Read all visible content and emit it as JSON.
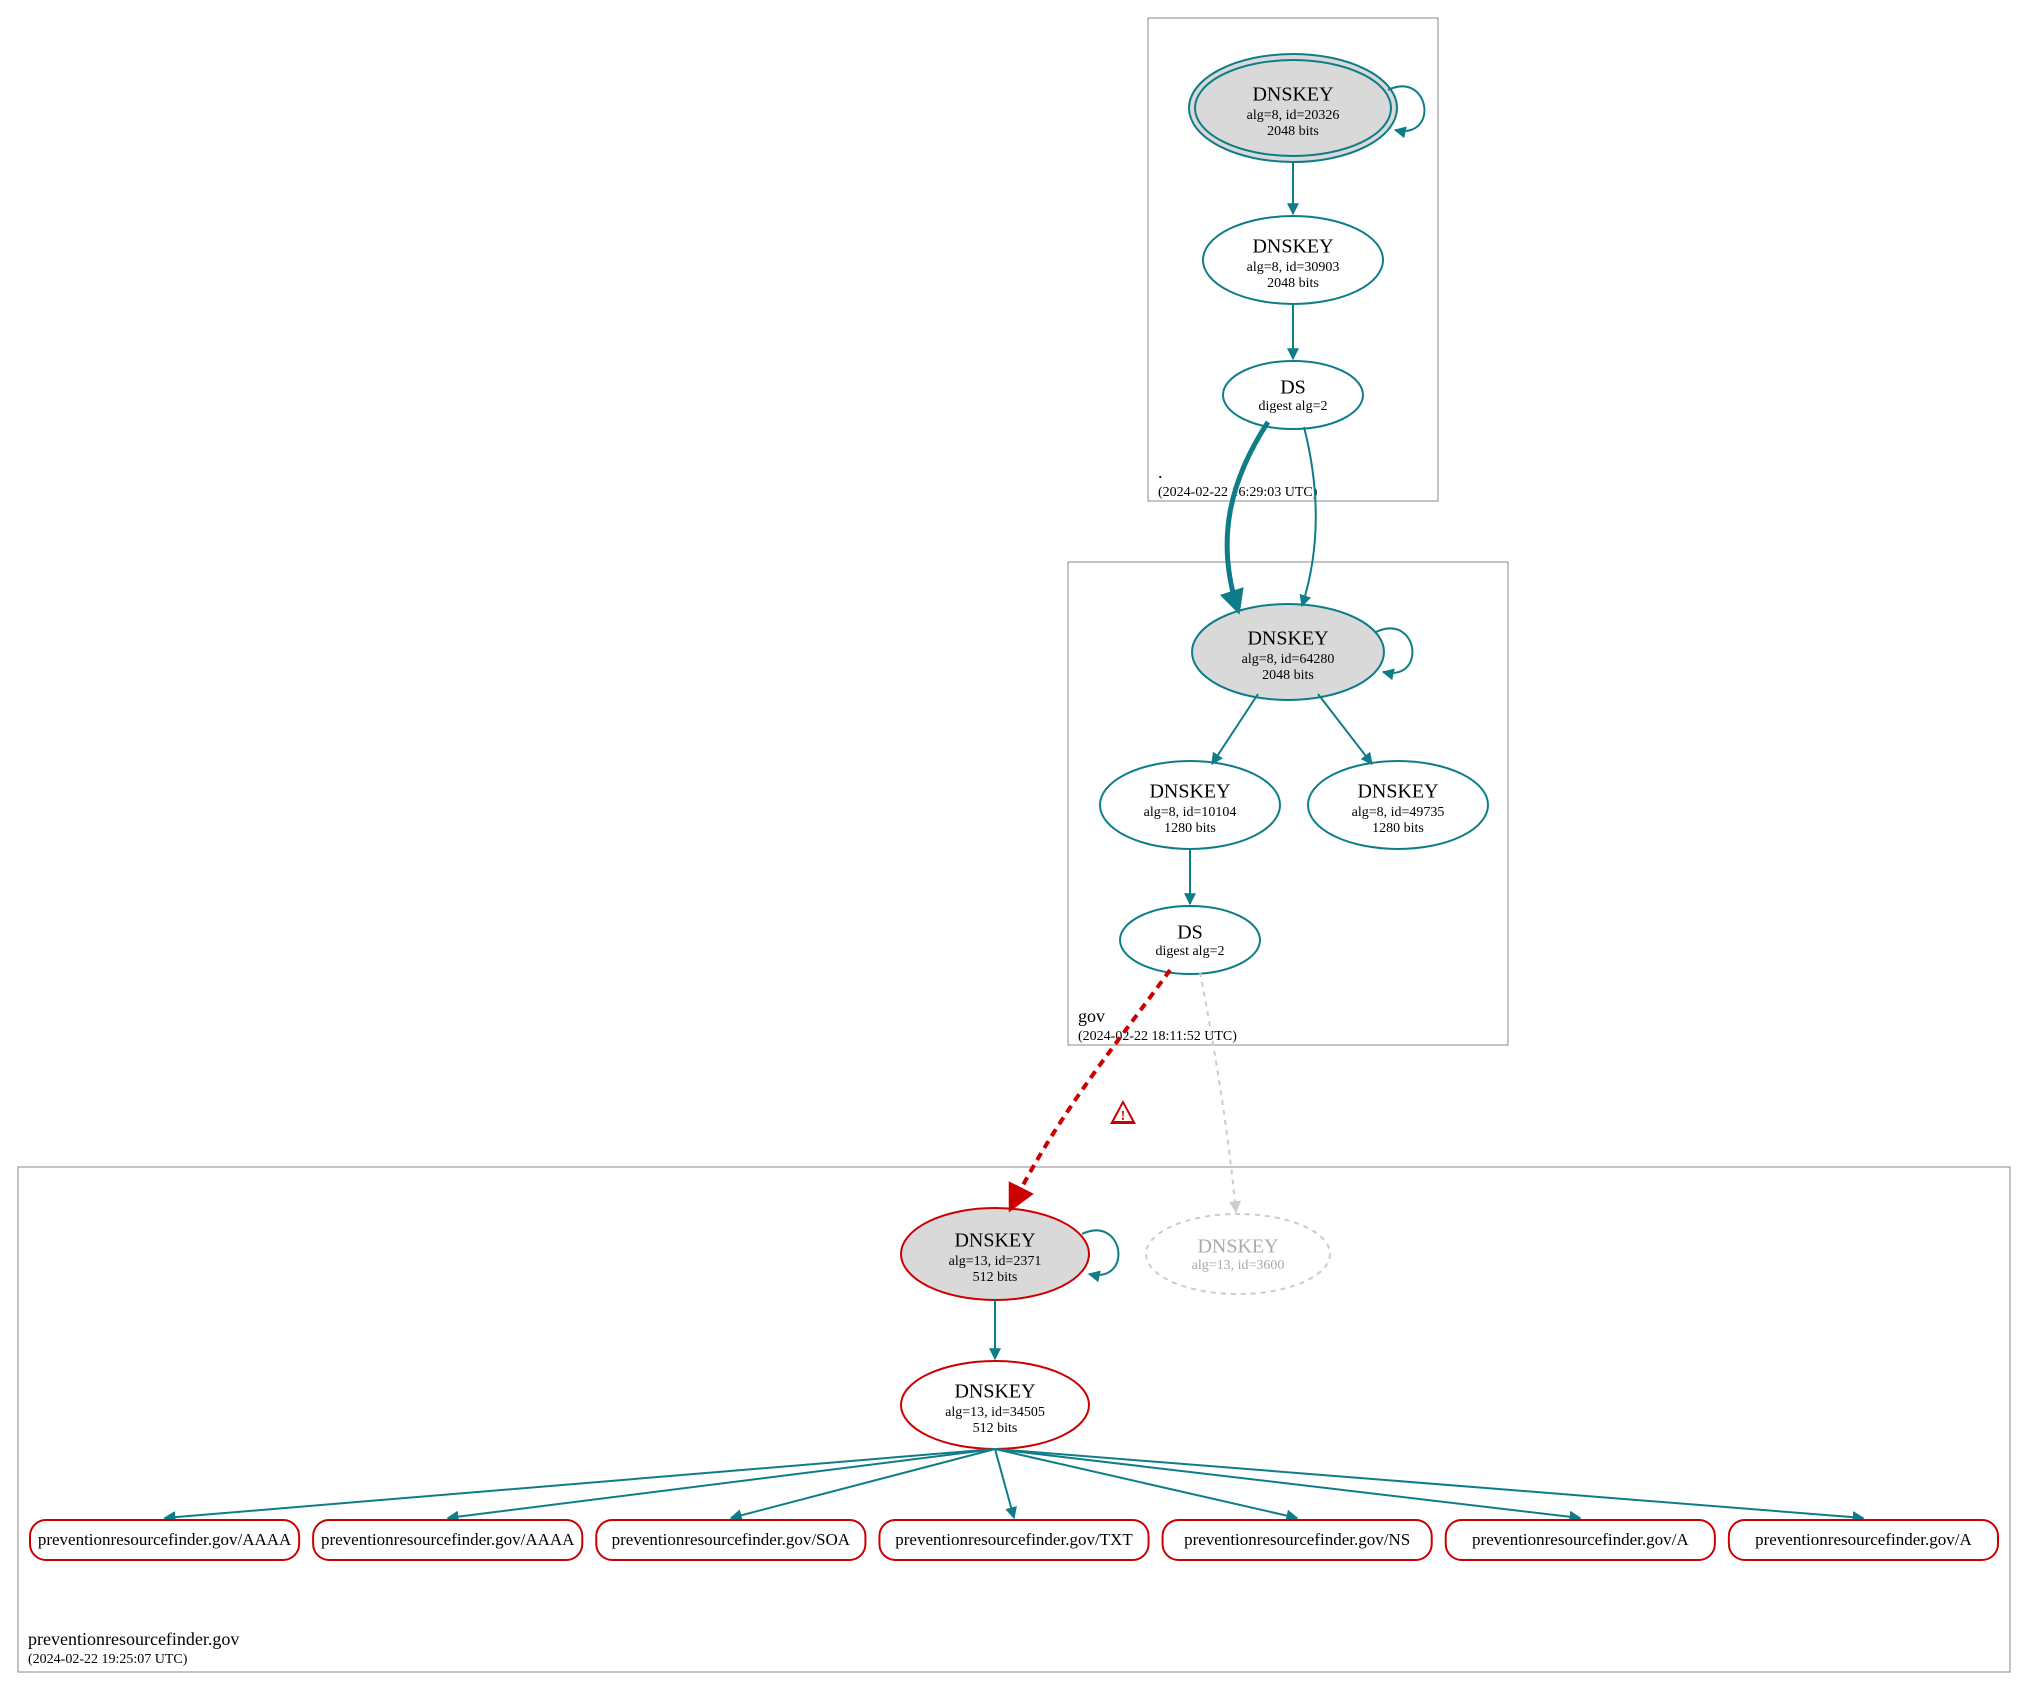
{
  "colors": {
    "teal": "#0f7d87",
    "red": "#cc0000",
    "grey": "#cccccc",
    "greyFill": "#d9d9d9",
    "box": "#888888"
  },
  "zones": {
    "root": {
      "label": ".",
      "timestamp": "(2024-02-22 16:29:03 UTC)",
      "nodes": {
        "ksk": {
          "title": "DNSKEY",
          "line1": "alg=8, id=20326",
          "line2": "2048 bits"
        },
        "zsk": {
          "title": "DNSKEY",
          "line1": "alg=8, id=30903",
          "line2": "2048 bits"
        },
        "ds": {
          "title": "DS",
          "line1": "digest alg=2"
        }
      }
    },
    "gov": {
      "label": "gov",
      "timestamp": "(2024-02-22 18:11:52 UTC)",
      "nodes": {
        "ksk": {
          "title": "DNSKEY",
          "line1": "alg=8, id=64280",
          "line2": "2048 bits"
        },
        "zsk1": {
          "title": "DNSKEY",
          "line1": "alg=8, id=10104",
          "line2": "1280 bits"
        },
        "zsk2": {
          "title": "DNSKEY",
          "line1": "alg=8, id=49735",
          "line2": "1280 bits"
        },
        "ds": {
          "title": "DS",
          "line1": "digest alg=2"
        }
      }
    },
    "prf": {
      "label": "preventionresourcefinder.gov",
      "timestamp": "(2024-02-22 19:25:07 UTC)",
      "nodes": {
        "ksk": {
          "title": "DNSKEY",
          "line1": "alg=13, id=2371",
          "line2": "512 bits"
        },
        "ghost": {
          "title": "DNSKEY",
          "line1": "alg=13, id=3600"
        },
        "zsk": {
          "title": "DNSKEY",
          "line1": "alg=13, id=34505",
          "line2": "512 bits"
        }
      }
    }
  },
  "records": [
    "preventionresourcefinder.gov/AAAA",
    "preventionresourcefinder.gov/AAAA",
    "preventionresourcefinder.gov/SOA",
    "preventionresourcefinder.gov/TXT",
    "preventionresourcefinder.gov/NS",
    "preventionresourcefinder.gov/A",
    "preventionresourcefinder.gov/A"
  ],
  "warning_glyph": "⚠"
}
